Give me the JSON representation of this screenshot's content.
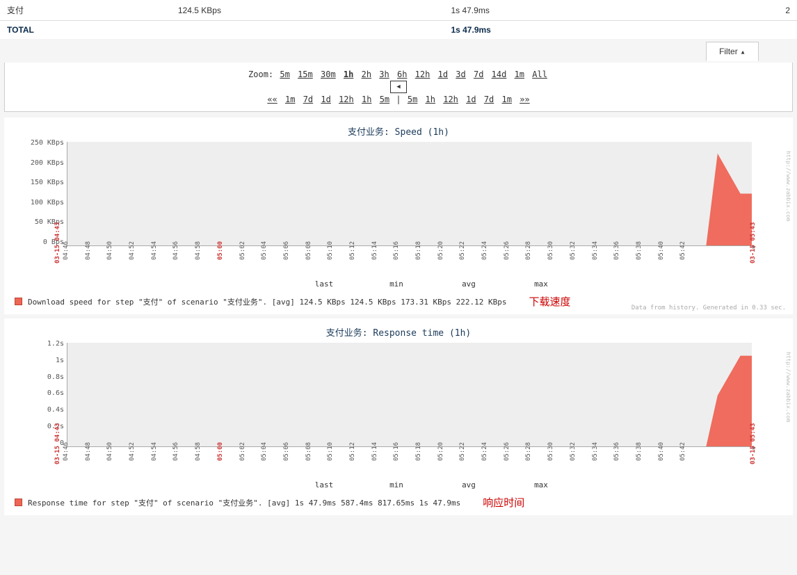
{
  "summary": {
    "rows": [
      {
        "name": "支付",
        "speed": "124.5 KBps",
        "time": "1s 47.9ms",
        "extra": "2"
      },
      {
        "name": "TOTAL",
        "speed": "",
        "time": "1s 47.9ms"
      }
    ]
  },
  "filter": {
    "label": "Filter"
  },
  "zoom": {
    "label": "Zoom:",
    "options": [
      "5m",
      "15m",
      "30m",
      "1h",
      "2h",
      "3h",
      "6h",
      "12h",
      "1d",
      "3d",
      "7d",
      "14d",
      "1m",
      "All"
    ],
    "selected": "1h",
    "nav_left": [
      "1m",
      "7d",
      "1d",
      "12h",
      "1h",
      "5m"
    ],
    "nav_right": [
      "5m",
      "1h",
      "12h",
      "1d",
      "7d",
      "1m"
    ],
    "ll": "««",
    "rr": "»»",
    "sep": "|"
  },
  "chart_data": [
    {
      "type": "area",
      "title": "支付业务: Speed (1h)",
      "ylim": [
        0,
        250
      ],
      "y_ticks": [
        "250 KBps",
        "200 KBps",
        "150 KBps",
        "100 KBps",
        "50 KBps",
        "0 Bps"
      ],
      "x_ticks": [
        "04:46",
        "04:48",
        "04:50",
        "04:52",
        "04:54",
        "04:56",
        "04:58",
        "05:00",
        "05:02",
        "05:04",
        "05:06",
        "05:08",
        "05:10",
        "05:12",
        "05:14",
        "05:16",
        "05:18",
        "05:20",
        "05:22",
        "05:24",
        "05:26",
        "05:28",
        "05:30",
        "05:32",
        "05:34",
        "05:36",
        "05:38",
        "05:40",
        "05:42"
      ],
      "x_highlight": [
        "05:00"
      ],
      "x_start_label": "03-15 04:43",
      "x_end_label": "03-15 05:43",
      "series": [
        {
          "name": "Download speed for step \"支付\" of scenario \"支付业务\".",
          "x": [
            "05:39",
            "05:40",
            "05:42",
            "05:43"
          ],
          "values": [
            0,
            222,
            125,
            125
          ],
          "color": "#ee5544"
        }
      ],
      "stats_headers": [
        "last",
        "min",
        "avg",
        "max"
      ],
      "stats": {
        "agg": "[avg]",
        "last": "124.5 KBps",
        "min": "124.5 KBps",
        "avg": "173.31 KBps",
        "max": "222.12 KBps"
      },
      "annotation": "下载速度",
      "source_note": "Data from history. Generated in 0.33 sec.",
      "side_url": "http://www.zabbix.com"
    },
    {
      "type": "area",
      "title": "支付业务: Response time (1h)",
      "ylim": [
        0,
        1.2
      ],
      "y_ticks": [
        "1.2s",
        "1s",
        "0.8s",
        "0.6s",
        "0.4s",
        "0.2s",
        "0"
      ],
      "x_ticks": [
        "04:46",
        "04:48",
        "04:50",
        "04:52",
        "04:54",
        "04:56",
        "04:58",
        "05:00",
        "05:02",
        "05:04",
        "05:06",
        "05:08",
        "05:10",
        "05:12",
        "05:14",
        "05:16",
        "05:18",
        "05:20",
        "05:22",
        "05:24",
        "05:26",
        "05:28",
        "05:30",
        "05:32",
        "05:34",
        "05:36",
        "05:38",
        "05:40",
        "05:42"
      ],
      "x_highlight": [
        "05:00"
      ],
      "x_start_label": "03-15 04:43",
      "x_end_label": "03-15 05:43",
      "series": [
        {
          "name": "Response time for step \"支付\" of scenario \"支付业务\".",
          "x": [
            "05:39",
            "05:40",
            "05:42",
            "05:43"
          ],
          "values": [
            0,
            0.59,
            1.05,
            1.05
          ],
          "color": "#ee5544"
        }
      ],
      "stats_headers": [
        "last",
        "min",
        "avg",
        "max"
      ],
      "stats": {
        "agg": "[avg]",
        "last": "1s 47.9ms",
        "min": "587.4ms",
        "avg": "817.65ms",
        "max": "1s 47.9ms"
      },
      "annotation": "响应时间",
      "side_url": "http://www.zabbix.com"
    }
  ]
}
